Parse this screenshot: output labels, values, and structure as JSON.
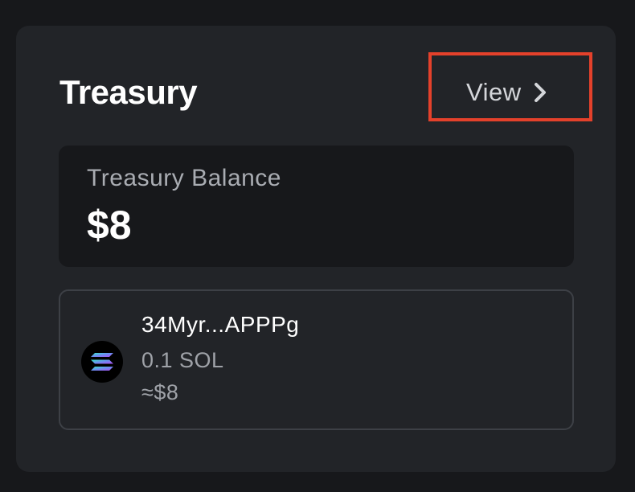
{
  "treasury": {
    "title": "Treasury",
    "view_label": "View",
    "view_icon": "chevron-right-icon",
    "highlight_color": "#e4412b"
  },
  "balance": {
    "label": "Treasury Balance",
    "value": "$8"
  },
  "token": {
    "icon": "solana-icon",
    "address": "34Myr...APPPg",
    "amount": "0.1 SOL",
    "usd_value": "≈$8"
  }
}
